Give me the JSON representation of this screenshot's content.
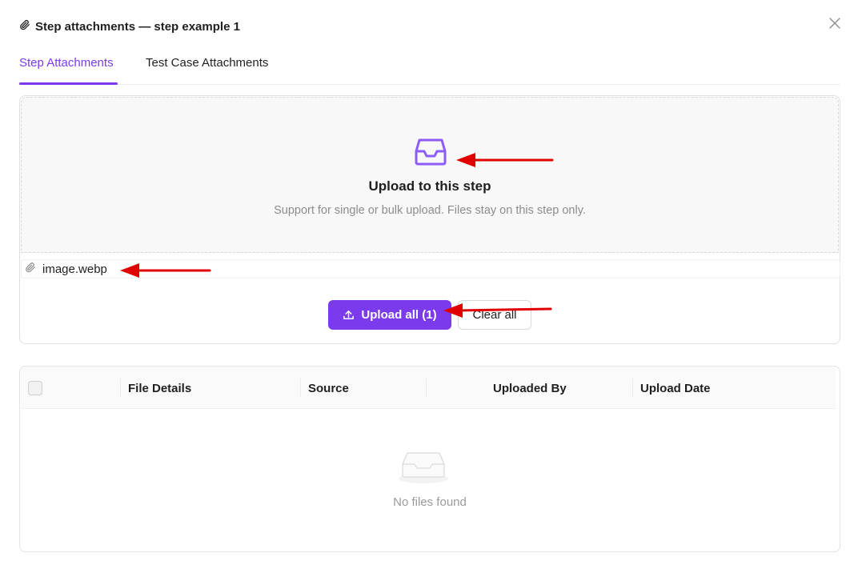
{
  "dialog": {
    "title": "Step attachments — step example 1",
    "icons": {
      "title": "paperclip-icon",
      "close": "close-icon"
    }
  },
  "tabs": [
    {
      "label": "Step Attachments",
      "active": true
    },
    {
      "label": "Test Case Attachments",
      "active": false
    }
  ],
  "dropzone": {
    "icon": "inbox-icon",
    "title": "Upload to this step",
    "subtitle": "Support for single or bulk upload. Files stay on this step only."
  },
  "pending_files": [
    {
      "name": "image.webp",
      "icon": "paperclip-icon"
    }
  ],
  "actions": {
    "upload_label": "Upload all (1)",
    "upload_icon": "upload-icon",
    "clear_label": "Clear all"
  },
  "table": {
    "columns": [
      "File Details",
      "Source",
      "Uploaded By",
      "Upload Date"
    ],
    "empty_text": "No files found",
    "empty_icon": "empty-inbox-icon"
  },
  "annotations": {
    "arrow_color": "#e00000"
  },
  "colors": {
    "accent": "#7c3aed",
    "muted_text": "#8c8c8c"
  }
}
